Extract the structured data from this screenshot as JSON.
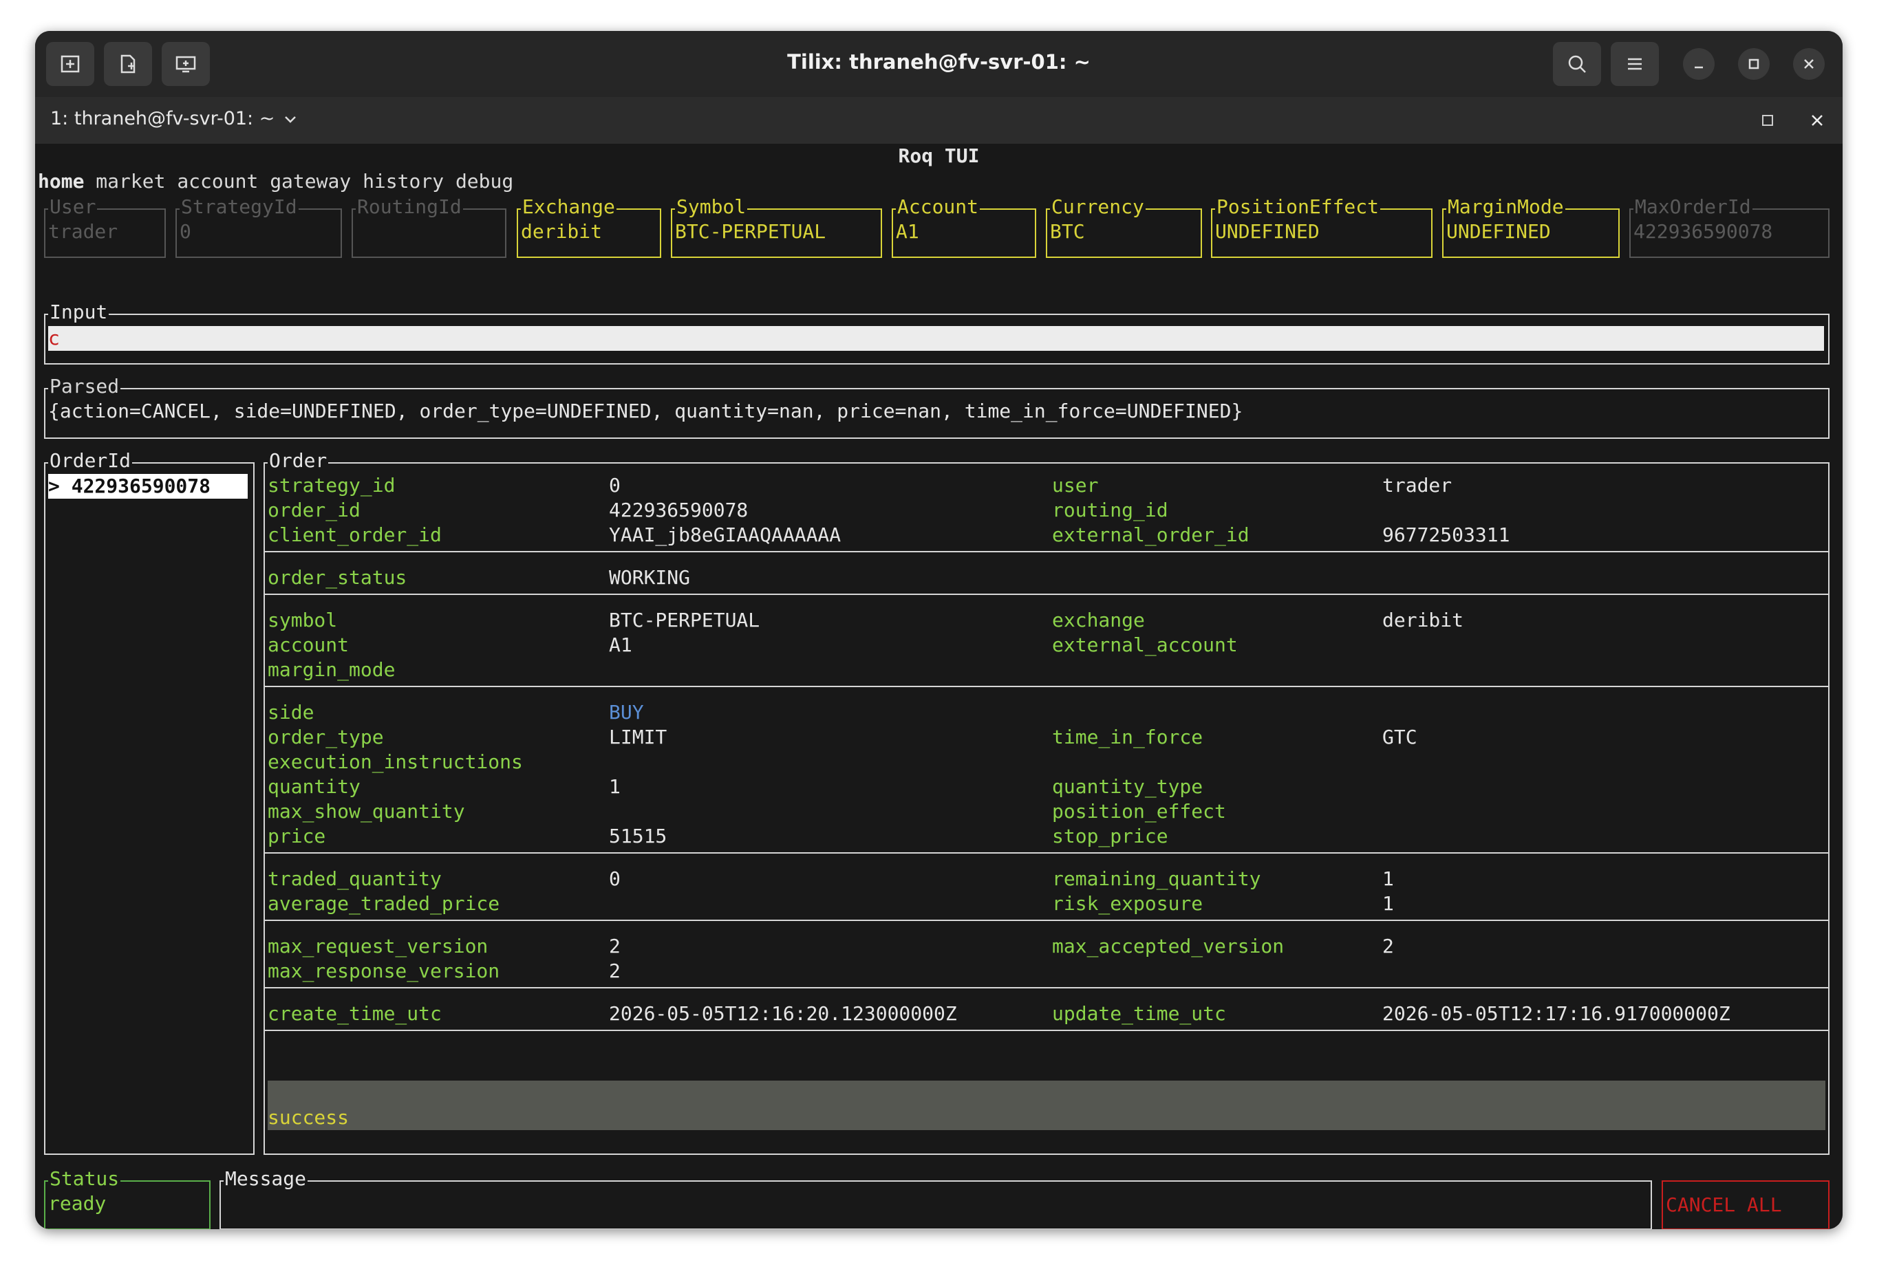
{
  "window": {
    "title": "Tilix: thraneh@fv-svr-01: ~",
    "tab_label": "1: thraneh@fv-svr-01: ~"
  },
  "app": {
    "title": "Roq TUI",
    "menu": [
      "home",
      "market",
      "account",
      "gateway",
      "history",
      "debug"
    ]
  },
  "fields": [
    {
      "label": "User",
      "value": "trader"
    },
    {
      "label": "StrategyId",
      "value": "0"
    },
    {
      "label": "RoutingId",
      "value": ""
    },
    {
      "label": "Exchange",
      "value": "deribit"
    },
    {
      "label": "Symbol",
      "value": "BTC-PERPETUAL"
    },
    {
      "label": "Account",
      "value": "A1"
    },
    {
      "label": "Currency",
      "value": "BTC"
    },
    {
      "label": "PositionEffect",
      "value": "UNDEFINED"
    },
    {
      "label": "MarginMode",
      "value": "UNDEFINED"
    },
    {
      "label": "MaxOrderId",
      "value": "422936590078"
    }
  ],
  "input": {
    "label": "Input",
    "value": "c"
  },
  "parsed": {
    "label": "Parsed",
    "value": "{action=CANCEL, side=UNDEFINED, order_type=UNDEFINED, quantity=nan, price=nan, time_in_force=UNDEFINED}"
  },
  "orderid_panel": {
    "label": "OrderId",
    "selected": "> 422936590078"
  },
  "order_panel": {
    "label": "Order",
    "sections": [
      {
        "rows": [
          {
            "k1": "strategy_id",
            "v1": "0",
            "k2": "user",
            "v2": "trader"
          },
          {
            "k1": "order_id",
            "v1": "422936590078",
            "k2": "routing_id",
            "v2": ""
          },
          {
            "k1": "client_order_id",
            "v1": "YAAI_jb8eGIAAQAAAAAA",
            "k2": "external_order_id",
            "v2": "96772503311"
          }
        ]
      },
      {
        "rows": [
          {
            "k1": "order_status",
            "v1": "WORKING",
            "k2": "",
            "v2": ""
          }
        ]
      },
      {
        "rows": [
          {
            "k1": "symbol",
            "v1": "BTC-PERPETUAL",
            "k2": "exchange",
            "v2": "deribit"
          },
          {
            "k1": "account",
            "v1": "A1",
            "k2": "external_account",
            "v2": ""
          },
          {
            "k1": "margin_mode",
            "v1": "",
            "k2": "",
            "v2": ""
          }
        ]
      },
      {
        "rows": [
          {
            "k1": "side",
            "v1": "BUY",
            "k2": "",
            "v2": ""
          },
          {
            "k1": "order_type",
            "v1": "LIMIT",
            "k2": "time_in_force",
            "v2": "GTC"
          },
          {
            "k1": "execution_instructions",
            "v1": "",
            "k2": "",
            "v2": ""
          },
          {
            "k1": "quantity",
            "v1": "1",
            "k2": "quantity_type",
            "v2": ""
          },
          {
            "k1": "max_show_quantity",
            "v1": "",
            "k2": "position_effect",
            "v2": ""
          },
          {
            "k1": "price",
            "v1": "51515",
            "k2": "stop_price",
            "v2": ""
          }
        ]
      },
      {
        "rows": [
          {
            "k1": "traded_quantity",
            "v1": "0",
            "k2": "remaining_quantity",
            "v2": "1"
          },
          {
            "k1": "average_traded_price",
            "v1": "",
            "k2": "risk_exposure",
            "v2": "1"
          }
        ]
      },
      {
        "rows": [
          {
            "k1": "max_request_version",
            "v1": "2",
            "k2": "max_accepted_version",
            "v2": "2"
          },
          {
            "k1": "max_response_version",
            "v1": "2",
            "k2": "",
            "v2": ""
          }
        ]
      },
      {
        "rows": [
          {
            "k1": "create_time_utc",
            "v1": "2026-05-05T12:16:20.123000000Z",
            "k2": "update_time_utc",
            "v2": "2026-05-05T12:17:16.917000000Z"
          }
        ]
      }
    ],
    "result": "success"
  },
  "status": {
    "label": "Status",
    "value": "ready"
  },
  "message": {
    "label": "Message",
    "value": ""
  },
  "cancel_all": "CANCEL ALL",
  "colors": {
    "key_green": "#8bd34a",
    "active_yellow": "#d9d438",
    "buy_blue": "#5b8fd6",
    "cancel_red": "#c81e1e",
    "bg": "#181818"
  },
  "icons": {
    "titlebar_left": [
      "add-terminal-icon",
      "add-session-icon",
      "sidebar-toggle-icon"
    ],
    "titlebar_right": [
      "search-icon",
      "hamburger-menu-icon",
      "minimize-icon",
      "maximize-icon",
      "close-icon"
    ]
  }
}
